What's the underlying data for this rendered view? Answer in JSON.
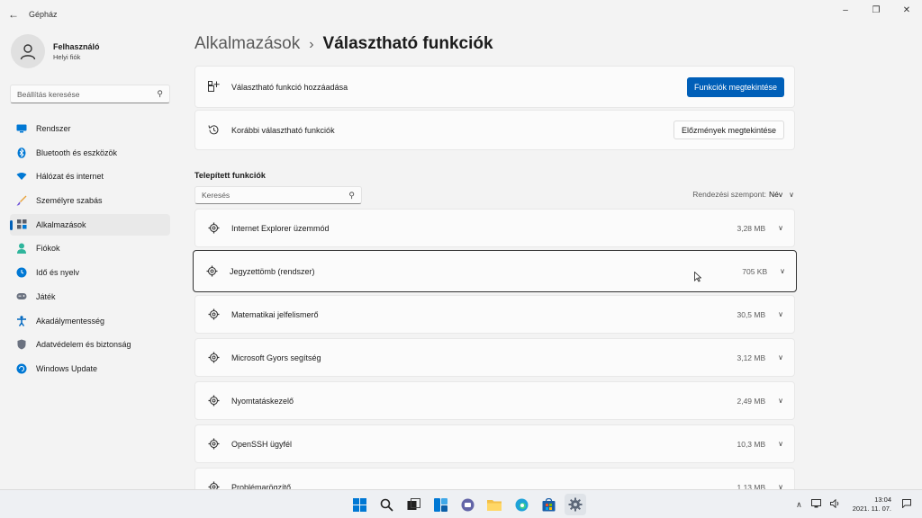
{
  "window": {
    "title": "Gépház"
  },
  "profile": {
    "name": "Felhasználó",
    "account_type": "Helyi fiók"
  },
  "sidebar": {
    "search_placeholder": "Beállítás keresése",
    "items": [
      {
        "label": "Rendszer",
        "icon": "monitor-icon",
        "color": "#0078d4"
      },
      {
        "label": "Bluetooth és eszközök",
        "icon": "bluetooth-icon",
        "color": "#0078d4"
      },
      {
        "label": "Hálózat és internet",
        "icon": "wifi-icon",
        "color": "#0078d4"
      },
      {
        "label": "Személyre szabás",
        "icon": "brush-icon",
        "color": "#e8a33d"
      },
      {
        "label": "Alkalmazások",
        "icon": "apps-icon",
        "color": "#5a5f6b",
        "active": true
      },
      {
        "label": "Fiókok",
        "icon": "person-icon",
        "color": "#2fb59c"
      },
      {
        "label": "Idő és nyelv",
        "icon": "globe-clock-icon",
        "color": "#0078d4"
      },
      {
        "label": "Játék",
        "icon": "gamepad-icon",
        "color": "#6b7280"
      },
      {
        "label": "Akadálymentesség",
        "icon": "accessibility-icon",
        "color": "#0067c0"
      },
      {
        "label": "Adatvédelem és biztonság",
        "icon": "shield-icon",
        "color": "#6b7280"
      },
      {
        "label": "Windows Update",
        "icon": "update-icon",
        "color": "#0078d4"
      }
    ]
  },
  "breadcrumb": {
    "parent": "Alkalmazások",
    "current": "Választható funkciók"
  },
  "cards": {
    "add": {
      "label": "Választható funkció hozzáadása",
      "button": "Funkciók megtekintése"
    },
    "history": {
      "label": "Korábbi választható funkciók",
      "button": "Előzmények megtekintése"
    }
  },
  "installed": {
    "title": "Telepített funkciók",
    "search_placeholder": "Keresés",
    "sort_label": "Rendezési szempont:",
    "sort_value": "Név",
    "features": [
      {
        "name": "Internet Explorer üzemmód",
        "size": "3,28 MB"
      },
      {
        "name": "Jegyzettömb (rendszer)",
        "size": "705 KB",
        "selected": true
      },
      {
        "name": "Matematikai jelfelismerő",
        "size": "30,5 MB"
      },
      {
        "name": "Microsoft Gyors segítség",
        "size": "3,12 MB"
      },
      {
        "name": "Nyomtatáskezelő",
        "size": "2,49 MB"
      },
      {
        "name": "OpenSSH ügyfél",
        "size": "10,3 MB"
      },
      {
        "name": "Problémarögzítő",
        "size": "1,13 MB"
      }
    ]
  },
  "taskbar": {
    "apps": [
      "windows-start-icon",
      "search-icon",
      "task-view-icon",
      "widgets-icon",
      "teams-chat-icon",
      "file-explorer-icon",
      "edge-icon",
      "store-icon",
      "settings-icon"
    ],
    "time": "13:04",
    "date": "2021. 11. 07."
  },
  "colors": {
    "accent": "#005fb8",
    "background": "#f3f3f3",
    "card": "#fbfbfb"
  }
}
